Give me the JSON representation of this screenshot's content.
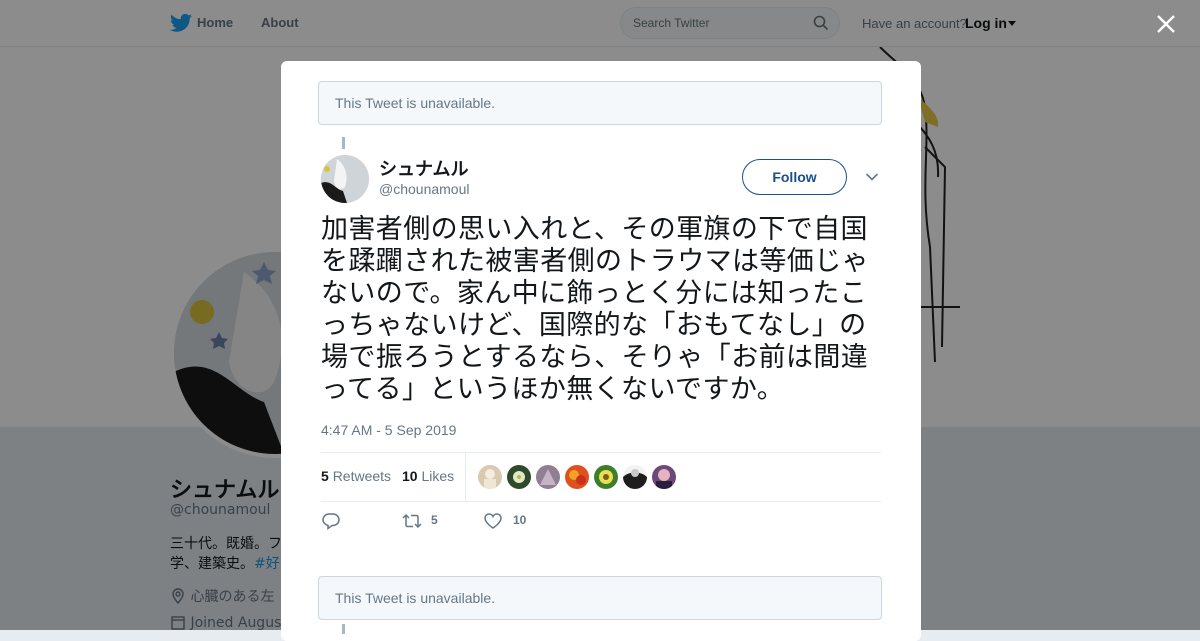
{
  "topnav": {
    "home_label": "Home",
    "about_label": "About",
    "search_placeholder": "Search Twitter",
    "account_prompt": "Have an account?",
    "login_label": "Log in"
  },
  "profile": {
    "name": "シュナムル",
    "handle": "@chounamoul",
    "bio_line1": "三十代。既婚。フ",
    "bio_line2": "学、建築史。",
    "bio_tag": "#好き",
    "location": "心臓のある左",
    "joined": "Joined August"
  },
  "modal": {
    "unavailable_text": "This Tweet is unavailable.",
    "tweet": {
      "author_name": "シュナムル",
      "author_handle": "@chounamoul",
      "follow_label": "Follow",
      "text": "加害者側の思い入れと、その軍旗の下で自国を蹂躙された被害者側のトラウマは等価じゃないので。家ん中に飾っとく分には知ったこっちゃないけど、国際的な「おもてなし」の場で振ろうとするなら、そりゃ「お前は間違ってる」というほか無くないですか。",
      "timestamp": "4:47 AM - 5 Sep 2019",
      "retweets_count": "5",
      "retweets_label": "Retweets",
      "likes_count": "10",
      "likes_label": "Likes",
      "reply_count": "",
      "retweet_action_count": "5",
      "like_action_count": "10"
    }
  },
  "colors": {
    "brand": "#1da1f2",
    "follow_border": "#1b4f88",
    "muted": "#657786"
  },
  "icons": [
    "twitter-bird-icon",
    "search-icon",
    "close-icon",
    "chevron-down-icon",
    "reply-icon",
    "retweet-icon",
    "heart-icon"
  ]
}
